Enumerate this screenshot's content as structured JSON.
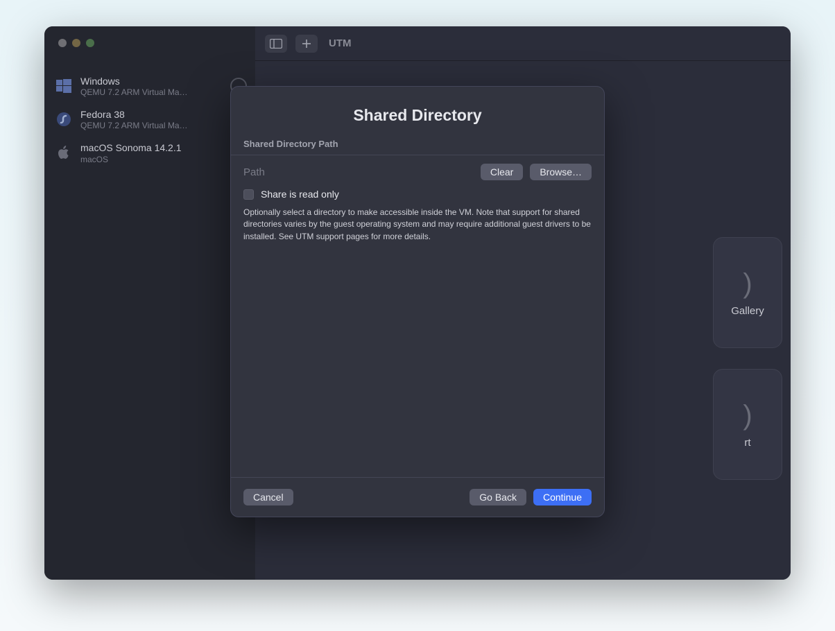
{
  "app": {
    "title": "UTM"
  },
  "sidebar": {
    "vms": [
      {
        "name": "Windows",
        "subtitle": "QEMU 7.2 ARM Virtual Ma…",
        "icon": "windows"
      },
      {
        "name": "Fedora 38",
        "subtitle": "QEMU 7.2 ARM Virtual Ma…",
        "icon": "fedora"
      },
      {
        "name": "macOS Sonoma 14.2.1",
        "subtitle": "macOS",
        "icon": "apple"
      }
    ]
  },
  "content": {
    "gallery_label": "Gallery",
    "support_label": "rt"
  },
  "modal": {
    "title": "Shared Directory",
    "section_header": "Shared Directory Path",
    "path_label": "Path",
    "clear_label": "Clear",
    "browse_label": "Browse…",
    "readonly_label": "Share is read only",
    "readonly_checked": false,
    "description": "Optionally select a directory to make accessible inside the VM. Note that support for shared directories varies by the guest operating system and may require additional guest drivers to be installed. See UTM support pages for more details.",
    "cancel_label": "Cancel",
    "goback_label": "Go Back",
    "continue_label": "Continue"
  }
}
